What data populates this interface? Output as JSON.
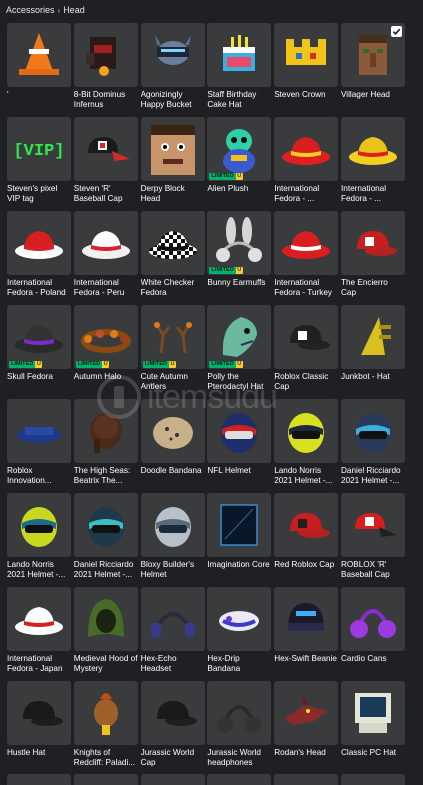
{
  "breadcrumb": {
    "parent": "Accessories",
    "separator": "›",
    "current": "Head"
  },
  "watermark_text": "itemsudu",
  "colors": {
    "page_background": "#1f2024",
    "tile_background": "#393b3d",
    "limited_green": "#00b06f",
    "limited_u_yellow": "#f5cd30"
  },
  "items": [
    {
      "name": "'",
      "icon": "traffic-cone-hat",
      "limited": false
    },
    {
      "name": "8-Bit Dominus Infernus",
      "icon": "dominus-hat",
      "limited": false
    },
    {
      "name": "Agonizingly Happy Bucket",
      "icon": "bucket-helmet",
      "limited": false
    },
    {
      "name": "Staff Birthday Cake Hat",
      "icon": "birthday-cake-hat",
      "limited": false
    },
    {
      "name": "Steven Crown",
      "icon": "pixel-crown",
      "limited": false
    },
    {
      "name": "Villager Head",
      "icon": "villager-head",
      "limited": false,
      "selected": true
    },
    {
      "name": "Steven's pixel VIP tag",
      "icon": "vip-tag",
      "limited": false,
      "tile_text": "[VIP]"
    },
    {
      "name": "Steven 'R' Baseball Cap",
      "icon": "r-baseball-cap",
      "limited": false
    },
    {
      "name": "Derpy Block Head",
      "icon": "derpy-block-head",
      "limited": false
    },
    {
      "name": "Alien Plush",
      "icon": "alien-plush",
      "limited": true
    },
    {
      "name": "International Fedora - ...",
      "icon": "fedora-red-yellow",
      "limited": false
    },
    {
      "name": "International Fedora - ...",
      "icon": "fedora-yellow-red",
      "limited": false
    },
    {
      "name": "International Fedora - Poland",
      "icon": "fedora-poland",
      "limited": false
    },
    {
      "name": "International Fedora - Peru",
      "icon": "fedora-peru",
      "limited": false
    },
    {
      "name": "White Checker Fedora",
      "icon": "checker-fedora",
      "limited": false
    },
    {
      "name": "Bunny Earmuffs",
      "icon": "bunny-earmuffs",
      "limited": true
    },
    {
      "name": "International Fedora - Turkey",
      "icon": "fedora-turkey",
      "limited": false
    },
    {
      "name": "The Encierro Cap",
      "icon": "encierro-cap",
      "limited": false
    },
    {
      "name": "Skull Fedora",
      "icon": "skull-fedora",
      "limited": true
    },
    {
      "name": "Autumn Halo",
      "icon": "autumn-halo",
      "limited": true
    },
    {
      "name": "Cute Autumn Antlers",
      "icon": "autumn-antlers",
      "limited": true
    },
    {
      "name": "Polly the Pterodactyl Hat",
      "icon": "pterodactyl-hat",
      "limited": true
    },
    {
      "name": "Roblox Classic Cap",
      "icon": "classic-cap",
      "limited": false
    },
    {
      "name": "Junkbot - Hat",
      "icon": "junkbot-hat",
      "limited": false
    },
    {
      "name": "Roblox Innovation...",
      "icon": "innovation-hat",
      "limited": false
    },
    {
      "name": "The High Seas: Beatrix The...",
      "icon": "beatrix-hair",
      "limited": false
    },
    {
      "name": "Doodle Bandana",
      "icon": "doodle-bandana",
      "limited": false
    },
    {
      "name": "NFL Helmet",
      "icon": "nfl-helmet",
      "limited": false
    },
    {
      "name": "Lando Norris 2021 Helmet -...",
      "icon": "lando-helmet",
      "limited": false
    },
    {
      "name": "Daniel Ricciardo 2021 Helmet -...",
      "icon": "ricciardo-helmet",
      "limited": false
    },
    {
      "name": "Lando Norris 2021 Helmet -...",
      "icon": "lando-helmet-2",
      "limited": false
    },
    {
      "name": "Daniel Ricciardo 2021 Helmet -...",
      "icon": "ricciardo-helmet-2",
      "limited": false
    },
    {
      "name": "Bloxy Builder's Helmet",
      "icon": "builder-helmet",
      "limited": false
    },
    {
      "name": "Imagination Core",
      "icon": "imagination-core",
      "limited": false
    },
    {
      "name": "Red Roblox Cap",
      "icon": "red-roblox-cap",
      "limited": false
    },
    {
      "name": "ROBLOX 'R' Baseball Cap",
      "icon": "roblox-r-cap",
      "limited": false
    },
    {
      "name": "International Fedora - Japan",
      "icon": "fedora-japan",
      "limited": false
    },
    {
      "name": "Medieval Hood of Mystery",
      "icon": "medieval-hood",
      "limited": false
    },
    {
      "name": "Hex-Echo Headset",
      "icon": "hex-echo-headset",
      "limited": false
    },
    {
      "name": "Hex-Drip Bandana",
      "icon": "hex-drip-bandana",
      "limited": false
    },
    {
      "name": "Hex-Swift Beanie",
      "icon": "hex-swift-beanie",
      "limited": false
    },
    {
      "name": "Cardio Cans",
      "icon": "cardio-cans",
      "limited": false
    },
    {
      "name": "Hustle Hat",
      "icon": "hustle-hat",
      "limited": false
    },
    {
      "name": "Knights of Redcliff: Paladi...",
      "icon": "paladin-helm",
      "limited": false
    },
    {
      "name": "Jurassic World Cap",
      "icon": "jurassic-cap",
      "limited": false
    },
    {
      "name": "Jurassic World headphones",
      "icon": "jurassic-headphones",
      "limited": false
    },
    {
      "name": "Rodan's Head",
      "icon": "rodan-head",
      "limited": false
    },
    {
      "name": "Classic PC Hat",
      "icon": "classic-pc-hat",
      "limited": false
    }
  ],
  "limited_badge": {
    "text": "LIMITED",
    "u": "U"
  }
}
